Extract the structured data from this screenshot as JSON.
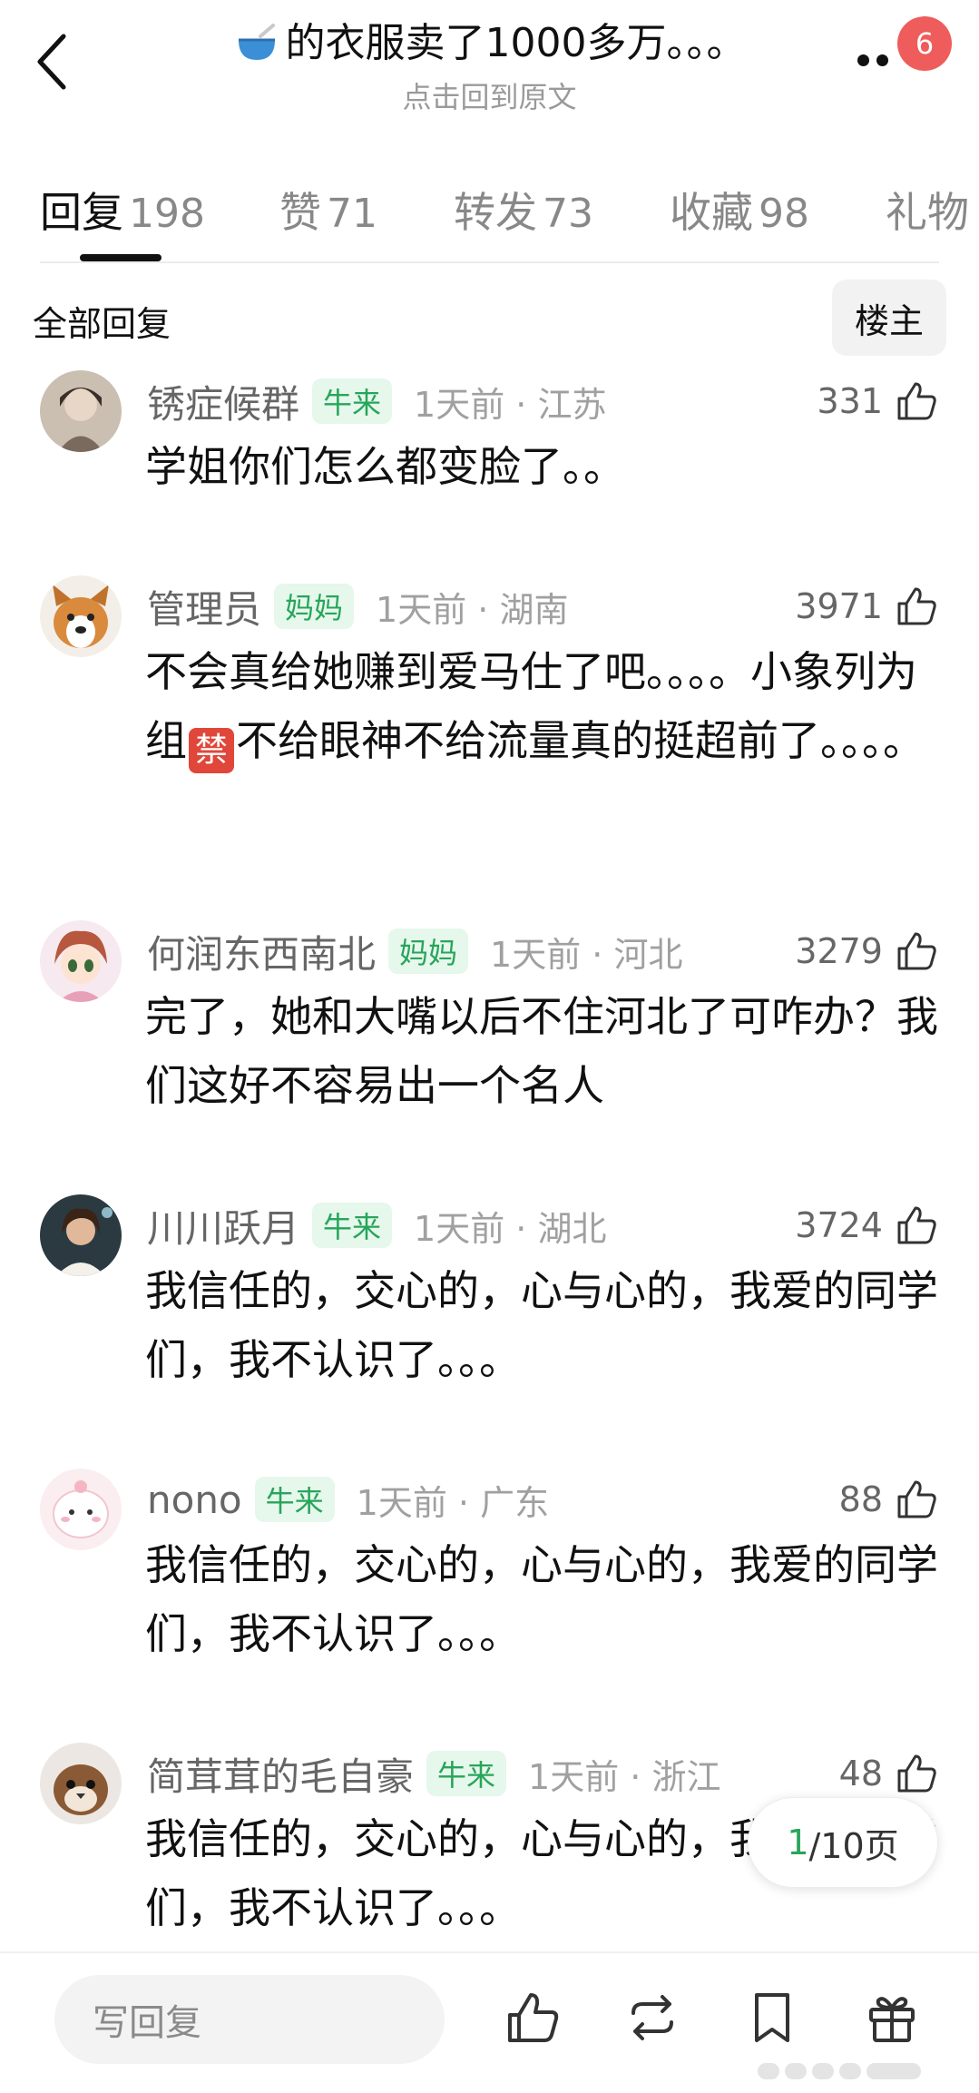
{
  "header": {
    "title_emoji": "bowl-icon",
    "title": "的衣服卖了1000多万。。。",
    "subtitle": "点击回到原文",
    "notification_count": "6"
  },
  "tabs": [
    {
      "label": "回复",
      "count": "198",
      "active": true
    },
    {
      "label": "赞",
      "count": "71"
    },
    {
      "label": "转发",
      "count": "73"
    },
    {
      "label": "收藏",
      "count": "98"
    },
    {
      "label": "礼物",
      "count": ""
    }
  ],
  "sort": {
    "all_label": "全部回复",
    "op_label": "楼主"
  },
  "comments": [
    {
      "username": "锈症候群",
      "badge": "牛来",
      "time": "1天前 · 江苏",
      "likes": "331",
      "content": "学姐你们怎么都变脸了。。"
    },
    {
      "username": "管理员",
      "badge": "妈妈",
      "time": "1天前 · 湖南",
      "likes": "3971",
      "content_before": "不会真给她赚到爱马仕了吧。。。。小象列为组",
      "emoji": "禁",
      "content_after": "不给眼神不给流量真的挺超前了。。。。"
    },
    {
      "username": "何润东西南北",
      "badge": "妈妈",
      "time": "1天前 · 河北",
      "likes": "3279",
      "content": "完了，她和大嘴以后不住河北了可咋办？我们这好不容易出一个名人"
    },
    {
      "username": "川川跃月",
      "badge": "牛来",
      "time": "1天前 · 湖北",
      "likes": "3724",
      "content": "我信任的，交心的，心与心的，我爱的同学们，我不认识了。。。"
    },
    {
      "username": "nono",
      "badge": "牛来",
      "time": "1天前 · 广东",
      "likes": "88",
      "content": "我信任的，交心的，心与心的，我爱的同学们，我不认识了。。。"
    },
    {
      "username": "简茸茸的毛自豪",
      "badge": "牛来",
      "time": "1天前 · 浙江",
      "likes": "48",
      "content": "我信任的，交心的，心与心的，我爱的同学们，我不认识了。。。"
    }
  ],
  "pagination": {
    "current": "1",
    "total": "/10页"
  },
  "bottom_bar": {
    "reply_placeholder": "写回复"
  },
  "colors": {
    "accent_green": "#27a55a",
    "badge_bg": "#e6f7ec",
    "notif_red": "#ef5c5c"
  }
}
